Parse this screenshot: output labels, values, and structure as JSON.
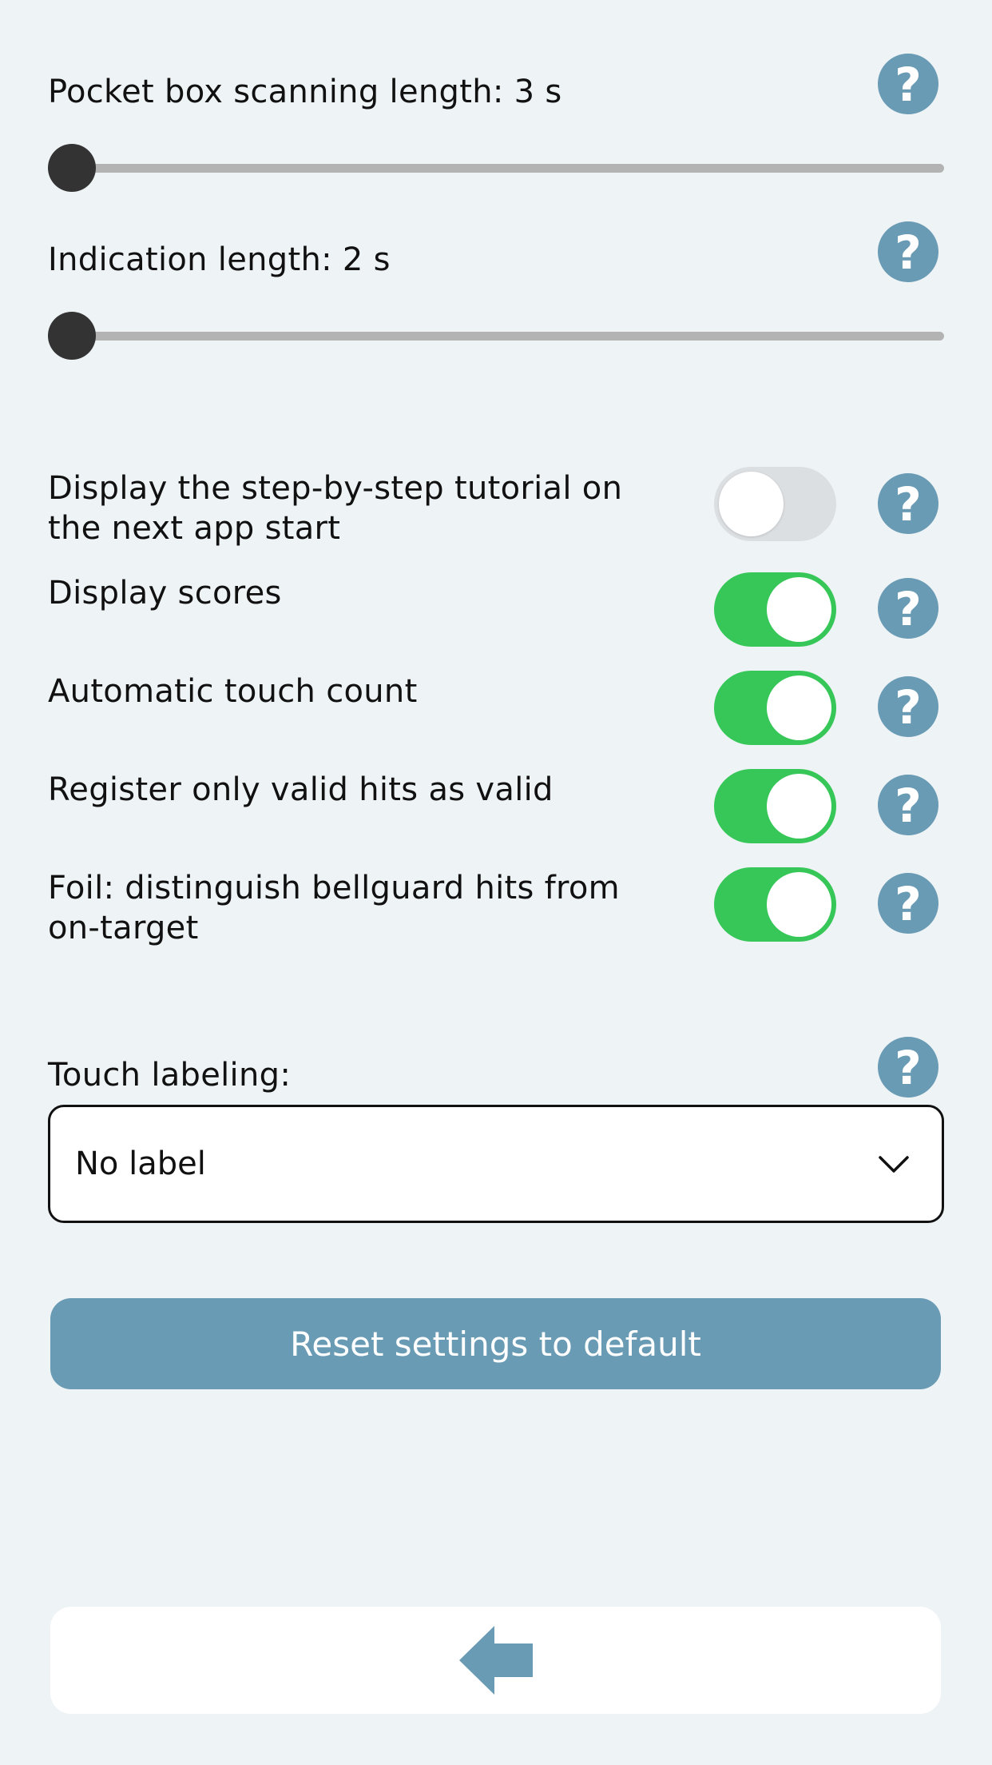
{
  "sliders": [
    {
      "label": "Pocket box scanning length: 3 s",
      "value": 0.0
    },
    {
      "label": "Indication length: 2 s",
      "value": 0.0
    }
  ],
  "toggles": [
    {
      "label": "Display the step-by-step tutorial on the next app start",
      "on": false
    },
    {
      "label": "Display scores",
      "on": true
    },
    {
      "label": "Automatic touch count",
      "on": true
    },
    {
      "label": "Register only valid hits as valid",
      "on": true
    },
    {
      "label": "Foil: distinguish bellguard hits from on-target",
      "on": true
    }
  ],
  "touch_labeling": {
    "label": "Touch labeling:",
    "selected": "No label"
  },
  "reset_button": "Reset settings to default",
  "help_glyph": "?",
  "icons": {
    "help": "question-mark-icon",
    "dropdown": "chevron-down-icon",
    "back": "arrow-left-icon"
  },
  "colors": {
    "background": "#eef3f6",
    "accent": "#6a9bb4",
    "toggle_on": "#36c758",
    "toggle_off": "#dcdfe2",
    "slider_track": "#b3b3b3",
    "slider_thumb": "#333333"
  }
}
